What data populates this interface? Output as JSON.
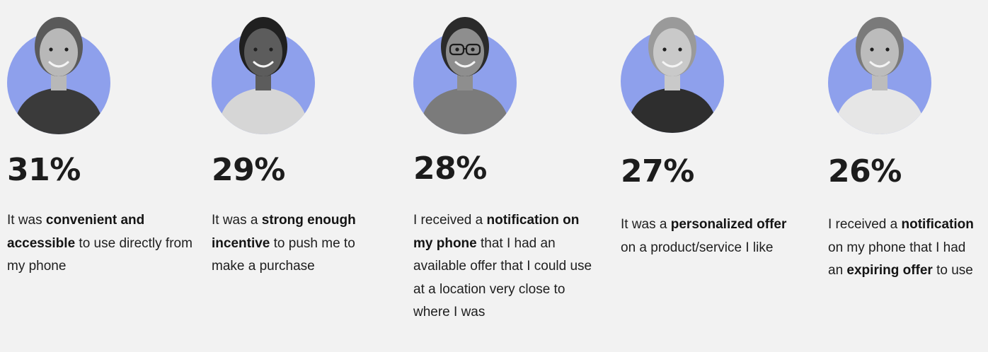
{
  "chart_data": {
    "type": "table",
    "title": "",
    "accent_color": "#8ea0ec",
    "unit": "%",
    "items": [
      {
        "value": 31,
        "label": "31%",
        "icon": "person-photo-icon",
        "description": [
          {
            "text": "It was ",
            "bold": false
          },
          {
            "text": "convenient and accessible",
            "bold": true
          },
          {
            "text": " to use directly from my phone",
            "bold": false
          }
        ]
      },
      {
        "value": 29,
        "label": "29%",
        "icon": "person-photo-icon",
        "description": [
          {
            "text": "It was a ",
            "bold": false
          },
          {
            "text": "strong enough incentive",
            "bold": true
          },
          {
            "text": " to push me to make a purchase",
            "bold": false
          }
        ]
      },
      {
        "value": 28,
        "label": "28%",
        "icon": "person-photo-icon",
        "description": [
          {
            "text": "I received a ",
            "bold": false
          },
          {
            "text": "notification on my phone",
            "bold": true
          },
          {
            "text": " that I had an available offer that I could use at a location very close to where I was",
            "bold": false
          }
        ]
      },
      {
        "value": 27,
        "label": "27%",
        "icon": "person-photo-icon",
        "description": [
          {
            "text": "It was a ",
            "bold": false
          },
          {
            "text": "personalized offer",
            "bold": true
          },
          {
            "text": " on a product/ser­vice I like",
            "bold": false
          }
        ]
      },
      {
        "value": 26,
        "label": "26%",
        "icon": "person-photo-icon",
        "description": [
          {
            "text": "I received a ",
            "bold": false
          },
          {
            "text": "notification",
            "bold": true
          },
          {
            "text": " on my phone that I had an ",
            "bold": false
          },
          {
            "text": "expiring offer",
            "bold": true
          },
          {
            "text": " to use",
            "bold": false
          }
        ]
      }
    ]
  }
}
